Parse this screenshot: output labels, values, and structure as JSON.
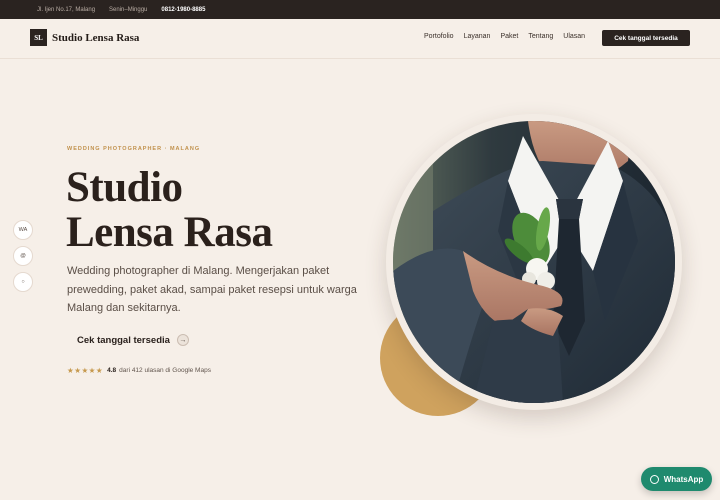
{
  "topbar": {
    "address": "Jl. Ijen No.17, Malang",
    "hours": "Senin–Minggu",
    "phone": "0812-1980-8885"
  },
  "brand": {
    "mark": "SL",
    "name": "Studio Lensa Rasa"
  },
  "nav": {
    "items": [
      "Portofolio",
      "Layanan",
      "Paket",
      "Tentang",
      "Ulasan"
    ],
    "cta": "Cek tanggal tersedia"
  },
  "social": [
    "WA",
    "@",
    "○"
  ],
  "hero": {
    "eyebrow": "WEDDING PHOTOGRAPHER · MALANG",
    "title_line1": "Studio",
    "title_line2": "Lensa Rasa",
    "description": "Wedding photographer di Malang. Mengerjakan paket prewedding, paket akad, sampai paket resepsi untuk warga Malang dan sekitarnya.",
    "cta": "Cek tanggal tersedia",
    "cta_arrow": "→",
    "rating_stars": "★★★★★",
    "rating_score": "4.8",
    "rating_text": "dari 412 ulasan di Google Maps"
  },
  "whatsapp_button": "WhatsApp",
  "colors": {
    "dark": "#2a2320",
    "accent_gold": "#cfa25e",
    "background": "#f6efe8",
    "whatsapp_green": "#1f8a6e"
  }
}
